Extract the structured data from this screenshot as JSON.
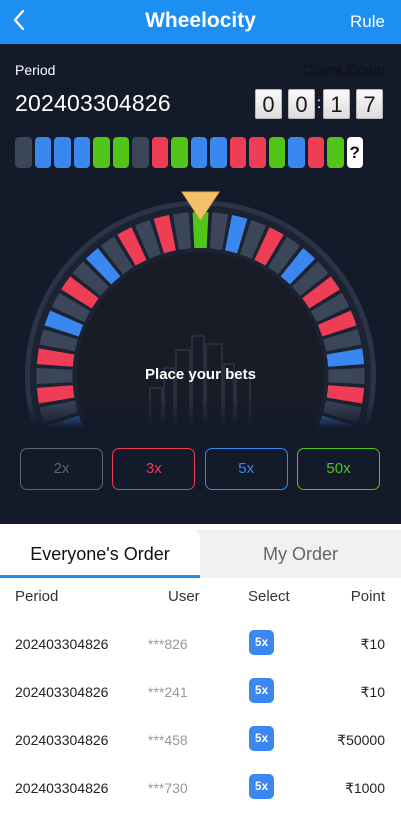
{
  "header": {
    "title": "Wheelocity",
    "rule_label": "Rule",
    "back_icon": "chevron-left-icon"
  },
  "game": {
    "period_label": "Period",
    "period_value": "202403304826",
    "countdown_label": "Count Down",
    "timer_digits": [
      "0",
      "0",
      "1",
      "7"
    ],
    "timer_separator": ":",
    "history": [
      "gray",
      "blue",
      "blue",
      "blue",
      "green",
      "green",
      "gray",
      "red",
      "green",
      "blue",
      "blue",
      "red",
      "red",
      "green",
      "blue",
      "red",
      "green"
    ],
    "history_unknown": "?",
    "place_bets_text": "Place your bets"
  },
  "multipliers": [
    {
      "label": "2x",
      "color": "#5d6470"
    },
    {
      "label": "3x",
      "color": "#ef3d55"
    },
    {
      "label": "5x",
      "color": "#3b87f0"
    },
    {
      "label": "50x",
      "color": "#52c41a"
    }
  ],
  "colors": {
    "gray": "#3c4659",
    "blue": "#3b87f0",
    "red": "#ef3d55",
    "green": "#52c41a",
    "accent": "#1d8ff2"
  },
  "tabs": {
    "everyone": "Everyone's Order",
    "mine": "My Order"
  },
  "table": {
    "headers": {
      "period": "Period",
      "user": "User",
      "select": "Select",
      "point": "Point"
    },
    "rows": [
      {
        "period": "202403304826",
        "user": "***826",
        "select": "5x",
        "point": "₹10"
      },
      {
        "period": "202403304826",
        "user": "***241",
        "select": "5x",
        "point": "₹10"
      },
      {
        "period": "202403304826",
        "user": "***458",
        "select": "5x",
        "point": "₹50000"
      },
      {
        "period": "202403304826",
        "user": "***730",
        "select": "5x",
        "point": "₹1000"
      }
    ]
  }
}
